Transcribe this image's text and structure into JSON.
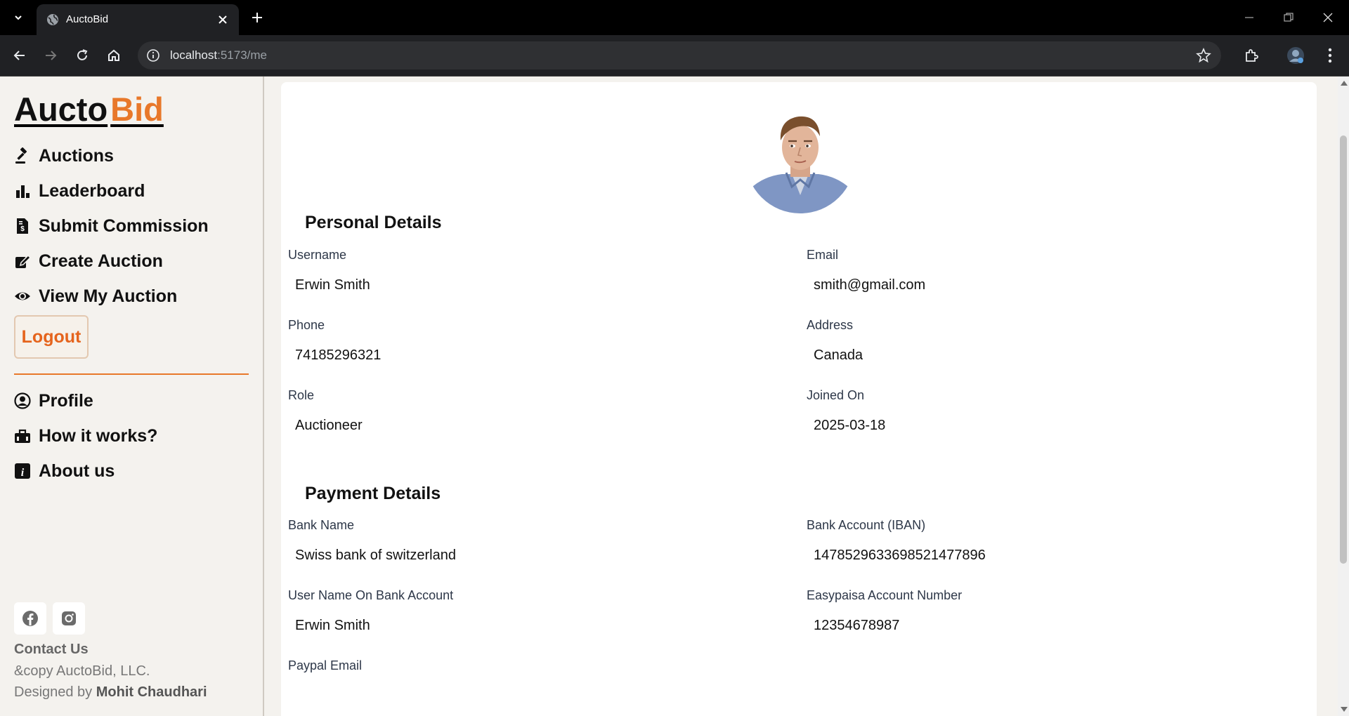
{
  "browser": {
    "tab_title": "AuctoBid",
    "url_host": "localhost",
    "url_rest": ":5173/me"
  },
  "sidebar": {
    "logo_part1": "Aucto",
    "logo_part2": "Bid",
    "nav": [
      {
        "label": "Auctions",
        "icon": "gavel-icon"
      },
      {
        "label": "Leaderboard",
        "icon": "bar-chart-icon"
      },
      {
        "label": "Submit Commission",
        "icon": "invoice-dollar-icon"
      },
      {
        "label": "Create Auction",
        "icon": "edit-icon"
      },
      {
        "label": "View My Auction",
        "icon": "eye-icon"
      }
    ],
    "logout_label": "Logout",
    "nav2": [
      {
        "label": "Profile",
        "icon": "user-circle-icon"
      },
      {
        "label": "How it works?",
        "icon": "toolbox-icon"
      },
      {
        "label": "About us",
        "icon": "info-icon"
      }
    ],
    "contact_label": "Contact Us",
    "copyright": "&copy AuctoBid, LLC.",
    "designed_prefix": "Designed by ",
    "designed_name": "Mohit Chaudhari"
  },
  "profile": {
    "personal_title": "Personal Details",
    "payment_title": "Payment Details",
    "personal": {
      "username_label": "Username",
      "username": "Erwin Smith",
      "email_label": "Email",
      "email": "smith@gmail.com",
      "phone_label": "Phone",
      "phone": "74185296321",
      "address_label": "Address",
      "address": "Canada",
      "role_label": "Role",
      "role": "Auctioneer",
      "joined_label": "Joined On",
      "joined": "2025-03-18"
    },
    "payment": {
      "bank_name_label": "Bank Name",
      "bank_name": "Swiss bank of switzerland",
      "iban_label": "Bank Account (IBAN)",
      "iban": "1478529633698521477896",
      "account_user_label": "User Name On Bank Account",
      "account_user": "Erwin Smith",
      "easypaisa_label": "Easypaisa Account Number",
      "easypaisa": "12354678987",
      "paypal_label": "Paypal Email"
    }
  },
  "colors": {
    "accent": "#e8782a",
    "logout_text": "#e5641d"
  }
}
